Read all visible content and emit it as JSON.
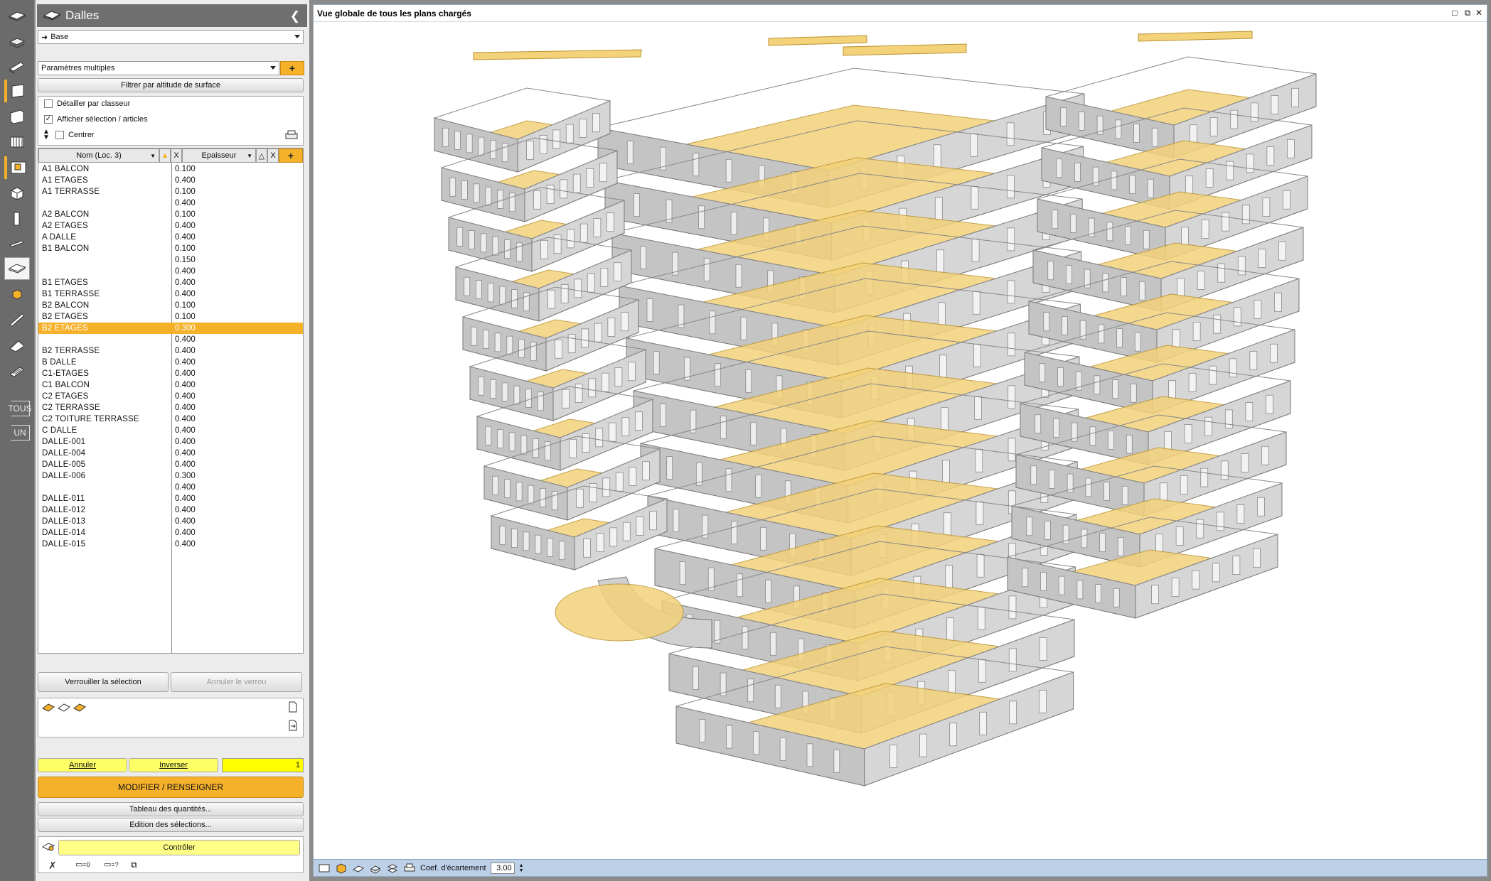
{
  "panel": {
    "title": "Dalles",
    "collapse_icon": "chevron-left-icon",
    "base_combo": "Base",
    "params_combo": "Paramètres multiples",
    "plus": "+",
    "filter_button": "Filtrer par altitude de surface",
    "options": {
      "detail_label": "Détailler par classeur",
      "detail_checked": false,
      "show_selection_label": "Afficher sélection / articles",
      "show_selection_checked": true,
      "center_label": "Centrer",
      "center_checked": false
    },
    "grid": {
      "col_name": "Nom (Loc. 3)",
      "col_thickness": "Epaisseur",
      "clear": "X",
      "rows": [
        {
          "name": "A1  BALCON",
          "value": "0.100"
        },
        {
          "name": "A1  ETAGES",
          "value": "0.400"
        },
        {
          "name": "A1  TERRASSE",
          "value": "0.100"
        },
        {
          "name": "",
          "value": "0.400"
        },
        {
          "name": "A2  BALCON",
          "value": "0.100"
        },
        {
          "name": "A2  ETAGES",
          "value": "0.400"
        },
        {
          "name": "A  DALLE",
          "value": "0.400"
        },
        {
          "name": "B1  BALCON",
          "value": "0.100"
        },
        {
          "name": "",
          "value": "0.150"
        },
        {
          "name": "",
          "value": "0.400"
        },
        {
          "name": "B1  ETAGES",
          "value": "0.400"
        },
        {
          "name": "B1  TERRASSE",
          "value": "0.400"
        },
        {
          "name": "B2  BALCON",
          "value": "0.100"
        },
        {
          "name": "B2  ETAGES",
          "value": "0.100"
        },
        {
          "name": "B2  ETAGES",
          "value": "0.300",
          "selected": true
        },
        {
          "name": "",
          "value": "0.400"
        },
        {
          "name": "B2  TERRASSE",
          "value": "0.400"
        },
        {
          "name": "B  DALLE",
          "value": "0.400"
        },
        {
          "name": "C1-ETAGES",
          "value": "0.400"
        },
        {
          "name": "C1  BALCON",
          "value": "0.400"
        },
        {
          "name": "C2  ETAGES",
          "value": "0.400"
        },
        {
          "name": "C2  TERRASSE",
          "value": "0.400"
        },
        {
          "name": "C2  TOITURE TERRASSE",
          "value": "0.400"
        },
        {
          "name": "C  DALLE",
          "value": "0.400"
        },
        {
          "name": "DALLE-001",
          "value": "0.400"
        },
        {
          "name": "DALLE-004",
          "value": "0.400"
        },
        {
          "name": "DALLE-005",
          "value": "0.400"
        },
        {
          "name": "DALLE-006",
          "value": "0.300"
        },
        {
          "name": "",
          "value": "0.400"
        },
        {
          "name": "DALLE-011",
          "value": "0.400"
        },
        {
          "name": "DALLE-012",
          "value": "0.400"
        },
        {
          "name": "DALLE-013",
          "value": "0.400"
        },
        {
          "name": "DALLE-014",
          "value": "0.400"
        },
        {
          "name": "DALLE-015",
          "value": "0.400"
        }
      ]
    },
    "lock_button": "Verrouiller la sélection",
    "unlock_button": "Annuler le verrou",
    "annuler": "Annuler",
    "inverser": "Inverser",
    "count": "1",
    "modifier": "MODIFIER / RENSEIGNER",
    "tableau": "Tableau des quantités...",
    "edition": "Edition des sélections...",
    "controler": "Contrôler",
    "badge_zero": "=0",
    "badge_q": "=?"
  },
  "toolbar": {
    "tous": "TOUS",
    "un": "UN"
  },
  "viewport": {
    "title": "Vue globale de tous les plans chargés",
    "coef_label": "Coef. d'écartement",
    "coef_value": "3.00"
  },
  "colors": {
    "accent": "#f6b12b",
    "highlight": "#ffff66",
    "slab": "#f3d27a",
    "wall": "#b9b9b9"
  }
}
